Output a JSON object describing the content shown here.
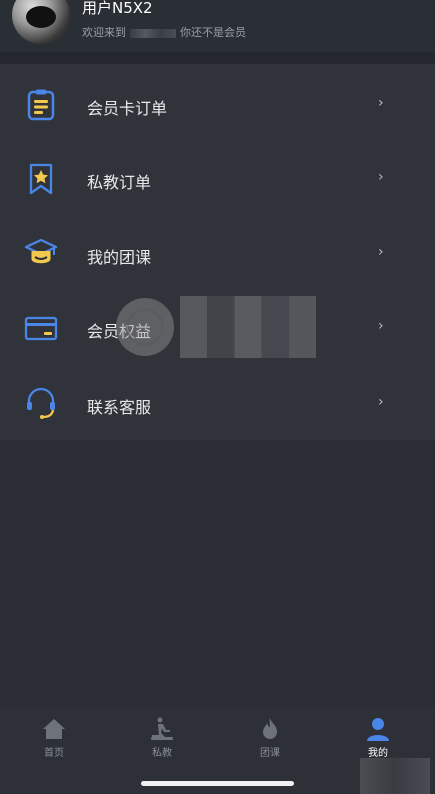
{
  "header": {
    "username": "用户N5X2",
    "welcome_prefix": "欢迎来到",
    "welcome_suffix": "你还不是会员"
  },
  "menu": {
    "items": [
      {
        "label": "会员卡订单",
        "icon": "clipboard-icon",
        "chevron": "›"
      },
      {
        "label": "私教订单",
        "icon": "bookmark-star-icon",
        "chevron": "›"
      },
      {
        "label": "我的团课",
        "icon": "graduation-cap-icon",
        "chevron": "›"
      },
      {
        "label": "会员权益",
        "icon": "credit-card-icon",
        "chevron": "›"
      },
      {
        "label": "联系客服",
        "icon": "headset-icon",
        "chevron": "›"
      }
    ]
  },
  "tabbar": {
    "tabs": [
      {
        "label": "首页",
        "icon": "home-icon",
        "active": false
      },
      {
        "label": "私教",
        "icon": "treadmill-icon",
        "active": false
      },
      {
        "label": "团课",
        "icon": "flame-icon",
        "active": false
      },
      {
        "label": "我的",
        "icon": "user-icon",
        "active": true
      }
    ]
  },
  "colors": {
    "background": "#2a2d33",
    "card": "#30333a",
    "icon_blue": "#4a86e8",
    "icon_yellow": "#f2c94c",
    "active_tab": "#4a86e8"
  }
}
